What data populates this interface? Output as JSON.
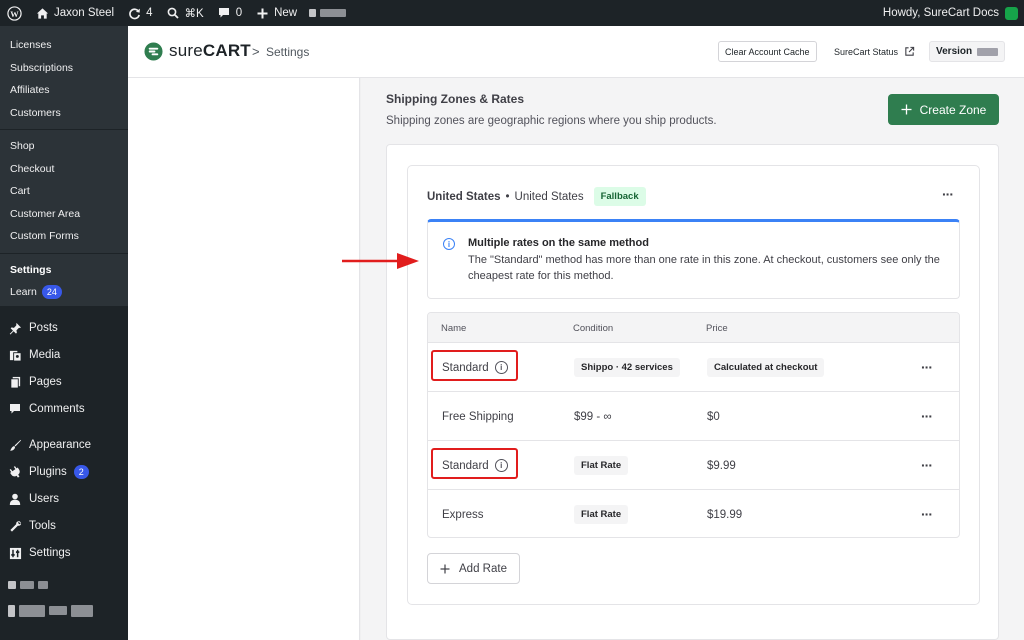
{
  "admin_bar": {
    "site_name": "Jaxon Steel",
    "updates_count": "4",
    "shortcut": "⌘K",
    "comments_count": "0",
    "new_label": "New",
    "greeting": "Howdy, SureCart Docs"
  },
  "sidebar": {
    "sub_items": [
      {
        "label": "Licenses"
      },
      {
        "label": "Subscriptions"
      },
      {
        "label": "Affiliates"
      },
      {
        "label": "Customers"
      },
      {
        "label": "Shop"
      },
      {
        "label": "Checkout"
      },
      {
        "label": "Cart"
      },
      {
        "label": "Customer Area"
      },
      {
        "label": "Custom Forms"
      },
      {
        "label": "Settings"
      },
      {
        "label": "Learn",
        "badge": "24"
      }
    ],
    "menu_items": [
      {
        "label": "Posts",
        "icon": "pin-icon"
      },
      {
        "label": "Media",
        "icon": "media-icon"
      },
      {
        "label": "Pages",
        "icon": "pages-icon"
      },
      {
        "label": "Comments",
        "icon": "comment-icon"
      },
      {
        "label": "Appearance",
        "icon": "brush-icon"
      },
      {
        "label": "Plugins",
        "icon": "plug-icon",
        "badge": "2"
      },
      {
        "label": "Users",
        "icon": "user-icon"
      },
      {
        "label": "Tools",
        "icon": "wrench-icon"
      },
      {
        "label": "Settings",
        "icon": "sliders-icon"
      }
    ]
  },
  "header": {
    "logo_sure": "sure",
    "logo_cart": "CART",
    "breadcrumb_sep": ">",
    "breadcrumb": "Settings",
    "clear_cache": "Clear Account Cache",
    "status_link": "SureCart Status",
    "version_label": "Version"
  },
  "section": {
    "title": "Shipping Zones & Rates",
    "description": "Shipping zones are geographic regions where you ship products.",
    "create_button": "Create Zone"
  },
  "zone": {
    "name": "United States",
    "separator": "•",
    "region": "United States",
    "badge": "Fallback",
    "alert": {
      "title": "Multiple rates on the same method",
      "text": "The \"Standard\" method has more than one rate in this zone. At checkout, customers see only the cheapest rate for this method."
    },
    "columns": {
      "name": "Name",
      "condition": "Condition",
      "price": "Price"
    },
    "rates": [
      {
        "name": "Standard",
        "condition": "Shippo · 42 services",
        "price": "Calculated at checkout",
        "condition_tag": true,
        "price_tag": true,
        "info": true
      },
      {
        "name": "Free Shipping",
        "condition": "$99 - ∞",
        "price": "$0",
        "condition_tag": false,
        "price_tag": false,
        "info": false
      },
      {
        "name": "Standard",
        "condition": "Flat Rate",
        "price": "$9.99",
        "condition_tag": true,
        "price_tag": false,
        "info": true
      },
      {
        "name": "Express",
        "condition": "Flat Rate",
        "price": "$19.99",
        "condition_tag": true,
        "price_tag": false,
        "info": false
      }
    ],
    "add_rate": "Add Rate"
  },
  "colors": {
    "accent_green": "#2f7d4f",
    "alert_blue": "#3b82f6",
    "highlight_red": "#e11d1d",
    "wp_dark": "#1d2327"
  }
}
